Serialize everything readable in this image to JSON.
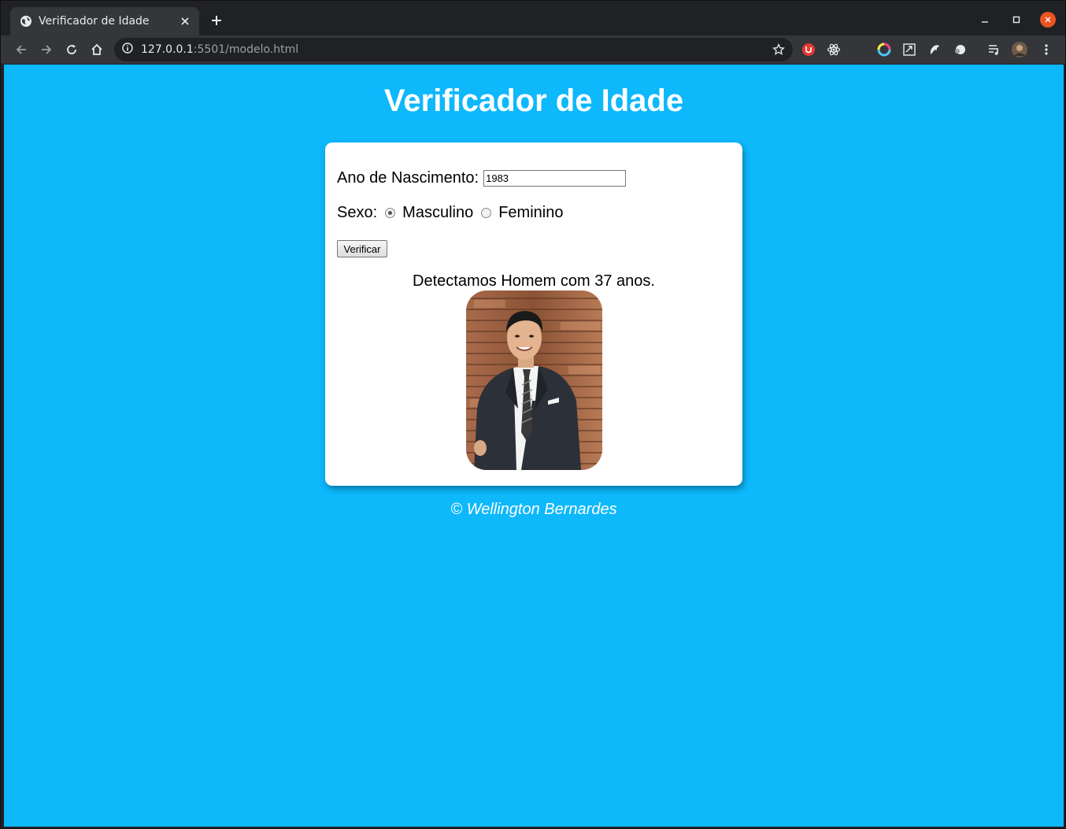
{
  "browser": {
    "tab_title": "Verificador de Idade",
    "url_host": "127.0.0.1",
    "url_rest": ":5501/modelo.html"
  },
  "page": {
    "title": "Verificador de Idade",
    "form": {
      "birth_year_label": "Ano de Nascimento:",
      "birth_year_value": "1983",
      "sex_label": "Sexo:",
      "option_male": "Masculino",
      "option_female": "Feminino",
      "selected": "Masculino",
      "submit_label": "Verificar"
    },
    "result_text": "Detectamos Homem com 37 anos.",
    "footer": "© Wellington Bernardes"
  },
  "colors": {
    "page_background": "#0db8fb",
    "card_background": "#ffffff",
    "title_color": "#ffffff"
  },
  "icons": [
    "globe-icon",
    "close-icon",
    "plus-icon",
    "minimize-icon",
    "maximize-icon",
    "window-close-icon",
    "back-icon",
    "forward-icon",
    "reload-icon",
    "home-icon",
    "info-icon",
    "star-icon",
    "extension-icon",
    "profile-avatar",
    "menu-icon"
  ]
}
